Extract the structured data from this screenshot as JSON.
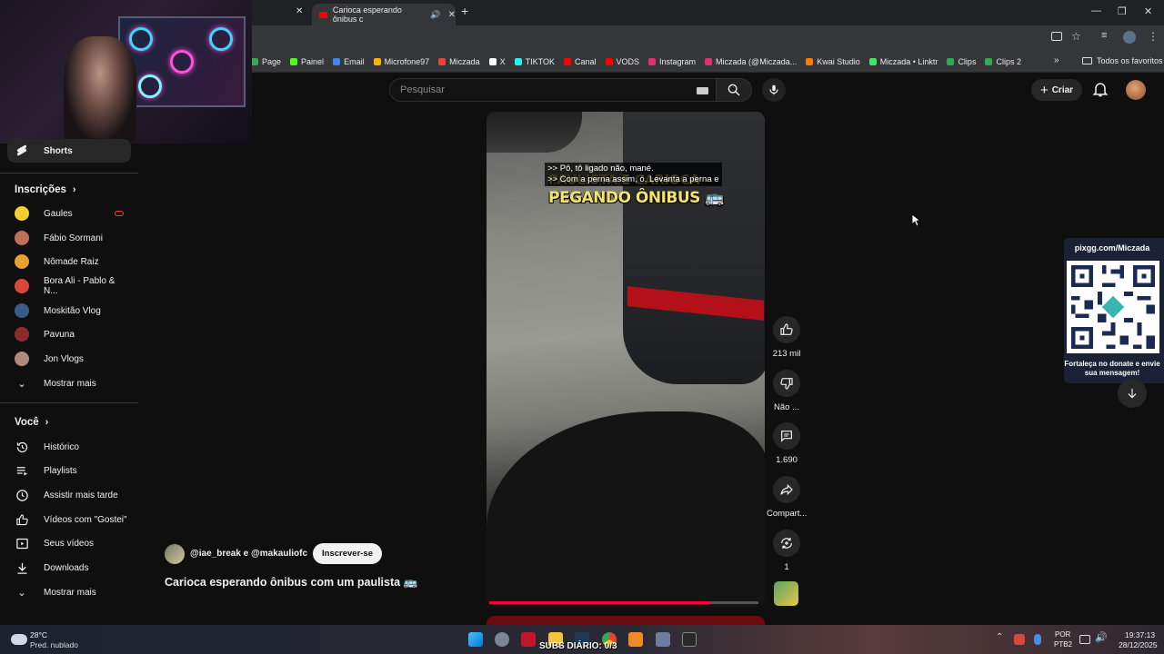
{
  "browser": {
    "active_tab_title": "Carioca esperando ônibus c",
    "new_tab_icon": "plus-icon",
    "bookmarks": [
      {
        "label": "Page",
        "color": "#34a853"
      },
      {
        "label": "Painel",
        "color": "#53fc18"
      },
      {
        "label": "Email",
        "color": "#4285f4"
      },
      {
        "label": "Microfone97",
        "color": "#f4b400"
      },
      {
        "label": "Miczada",
        "color": "#ea4335"
      },
      {
        "label": "X",
        "color": "#ffffff"
      },
      {
        "label": "TIKTOK",
        "color": "#25f4ee"
      },
      {
        "label": "Canal",
        "color": "#ff0000"
      },
      {
        "label": "VODS",
        "color": "#ff0000"
      },
      {
        "label": "Instagram",
        "color": "#e1306c"
      },
      {
        "label": "Miczada (@Miczada...",
        "color": "#e1306c"
      },
      {
        "label": "Kwai Studio",
        "color": "#ff7b00"
      },
      {
        "label": "Miczada • Linktr",
        "color": "#43e660"
      },
      {
        "label": "Clips",
        "color": "#34a853"
      },
      {
        "label": "Clips 2",
        "color": "#34a853"
      }
    ],
    "all_favorites": "Todos os favoritos"
  },
  "header": {
    "search_placeholder": "Pesquisar",
    "create_label": "Criar"
  },
  "sidebar": {
    "shorts_label": "Shorts",
    "subscriptions_heading": "Inscrições",
    "channels": [
      {
        "name": "Gaules",
        "color": "#f2d12e",
        "live": true
      },
      {
        "name": "Fábio Sormani",
        "color": "#c0705a",
        "live": false
      },
      {
        "name": "Nômade Raiz",
        "color": "#e8a12e",
        "live": false
      },
      {
        "name": "Bora Ali - Pablo & N...",
        "color": "#d9473c",
        "live": false
      },
      {
        "name": "Moskitão Vlog",
        "color": "#3a5a8a",
        "live": false
      },
      {
        "name": "Pavuna",
        "color": "#8a2a2a",
        "live": false
      },
      {
        "name": "Jon Vlogs",
        "color": "#b08a7a",
        "live": false
      }
    ],
    "show_more_1": "Mostrar mais",
    "you_heading": "Você",
    "you_items": [
      {
        "label": "Histórico",
        "icon": "history-icon"
      },
      {
        "label": "Playlists",
        "icon": "playlists-icon"
      },
      {
        "label": "Assistir mais tarde",
        "icon": "watch-later-icon"
      },
      {
        "label": "Vídeos com \"Gostei\"",
        "icon": "thumbs-up-icon"
      },
      {
        "label": "Seus vídeos",
        "icon": "your-videos-icon"
      },
      {
        "label": "Downloads",
        "icon": "download-icon"
      }
    ],
    "show_more_2": "Mostrar mais"
  },
  "video": {
    "caption_line1": ">> Pô, tô ligado não, mané.",
    "caption_line2": ">> Com a perna assim, ó. Levanta a perna e",
    "overlay_line1": "PAULISTA E CARIOCA",
    "overlay_line2": "PEGANDO ÔNIBUS 🚌",
    "progress": 0.82
  },
  "actions": {
    "like_count": "213 mil",
    "dislike_label": "Não ...",
    "comments_count": "1.690",
    "share_label": "Compart...",
    "remix_count": "1"
  },
  "channel": {
    "names": "@iae_break e @makauliofc",
    "subscribe_label": "Inscrever-se"
  },
  "video_title": "Carioca esperando ônibus com um paulista 🚌",
  "donate": {
    "url": "pixgg.com/Miczada",
    "message": "Fortaleça no donate e envie sua mensagem!"
  },
  "taskbar": {
    "temperature": "28°C",
    "weather": "Pred. nublado",
    "subs_counter": "SUBS DIÁRIO: 0/3",
    "lang_1": "POR",
    "lang_2": "PTB2",
    "time": "19:37:13",
    "date": "28/12/2025"
  }
}
